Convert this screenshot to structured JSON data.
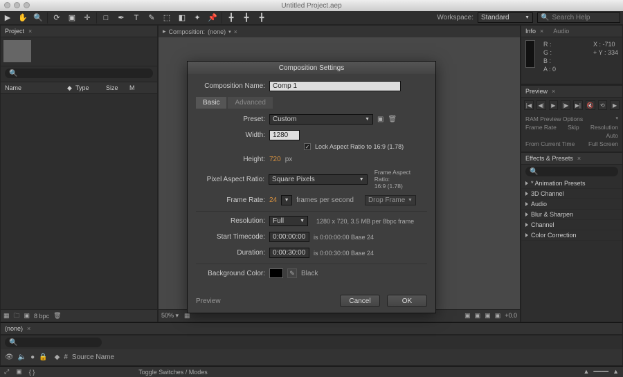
{
  "title": "Untitled Project.aep",
  "workspace": {
    "label": "Workspace:",
    "value": "Standard"
  },
  "search_help": {
    "placeholder": "Search Help"
  },
  "project": {
    "tab": "Project",
    "columns": {
      "name": "Name",
      "type": "Type",
      "size": "Size",
      "m": "M"
    },
    "footer_bpc": "8 bpc"
  },
  "comp": {
    "tab_prefix": "Composition:",
    "tab_value": "(none)",
    "footer_pct": "50%"
  },
  "info": {
    "tabs": {
      "info": "Info",
      "audio": "Audio"
    },
    "r": "R :",
    "g": "G :",
    "b": "B :",
    "a": "A :",
    "a_val": "0",
    "x": "X :",
    "x_val": "-710",
    "y": "Y :",
    "y_val": "334"
  },
  "preview": {
    "tab": "Preview",
    "ram_label": "RAM Preview Options",
    "frame_rate": "Frame Rate",
    "skip": "Skip",
    "resolution": "Resolution",
    "auto": "Auto",
    "from_current": "From Current Time",
    "full_screen": "Full Screen"
  },
  "effects": {
    "tab": "Effects & Presets",
    "items": [
      "* Animation Presets",
      "3D Channel",
      "Audio",
      "Blur & Sharpen",
      "Channel",
      "Color Correction"
    ]
  },
  "timeline": {
    "tab": "(none)",
    "source_name": "Source Name",
    "toggle": "Toggle Switches / Modes"
  },
  "footer_right": "+0.0",
  "dialog": {
    "title": "Composition Settings",
    "comp_name_label": "Composition Name:",
    "comp_name": "Comp 1",
    "tabs": {
      "basic": "Basic",
      "advanced": "Advanced"
    },
    "preset_label": "Preset:",
    "preset": "Custom",
    "width_label": "Width:",
    "width": "1280",
    "height_label": "Height:",
    "height": "720",
    "height_unit": "px",
    "lock_ar": "Lock Aspect Ratio to 16:9 (1.78)",
    "par_label": "Pixel Aspect Ratio:",
    "par": "Square Pixels",
    "far_label": "Frame Aspect Ratio:",
    "far_val": "16:9 (1.78)",
    "fps_label": "Frame Rate:",
    "fps": "24",
    "fps_unit": "frames per second",
    "drop": "Drop Frame",
    "res_label": "Resolution:",
    "res": "Full",
    "res_info": "1280 x 720, 3.5 MB per 8bpc frame",
    "start_tc_label": "Start Timecode:",
    "start_tc": "0:00:00:00",
    "start_tc_info": "is 0:00:00:00 Base 24",
    "duration_label": "Duration:",
    "duration": "0:00:30:00",
    "duration_info": "is 0:00:30:00 Base 24",
    "bg_label": "Background Color:",
    "bg_name": "Black",
    "preview": "Preview",
    "cancel": "Cancel",
    "ok": "OK"
  }
}
